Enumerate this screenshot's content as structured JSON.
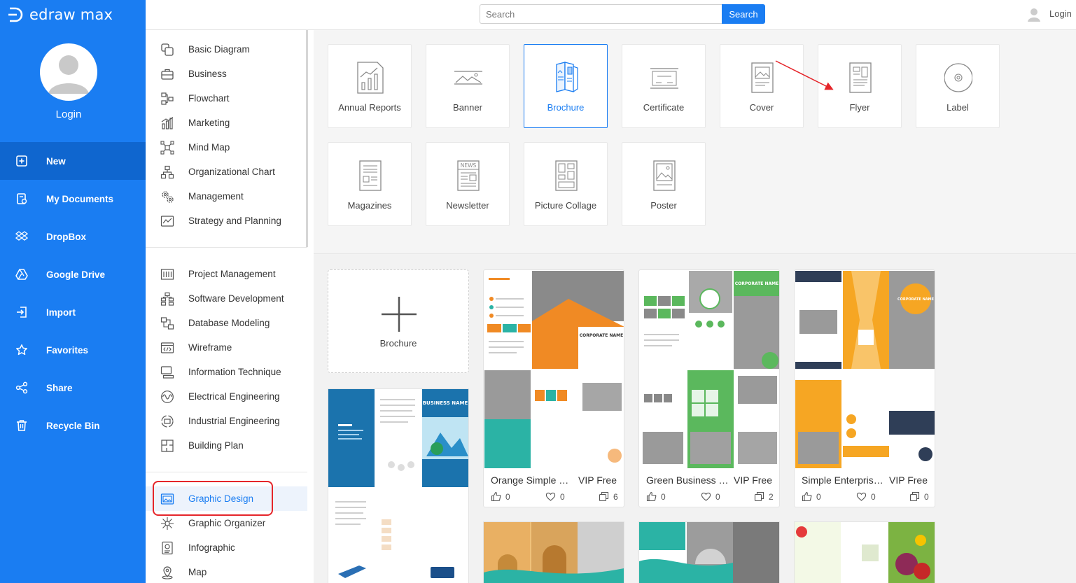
{
  "app": {
    "logo_text": "edraw max"
  },
  "sidebar": {
    "login_label": "Login",
    "nav": [
      {
        "label": "New",
        "icon": "new-file-icon",
        "active": true
      },
      {
        "label": "My Documents",
        "icon": "documents-icon"
      },
      {
        "label": "DropBox",
        "icon": "dropbox-icon"
      },
      {
        "label": "Google Drive",
        "icon": "google-drive-icon"
      },
      {
        "label": "Import",
        "icon": "import-icon"
      },
      {
        "label": "Favorites",
        "icon": "star-icon"
      },
      {
        "label": "Share",
        "icon": "share-icon"
      },
      {
        "label": "Recycle Bin",
        "icon": "trash-icon"
      }
    ]
  },
  "topbar": {
    "search_placeholder": "Search",
    "search_button": "Search",
    "login_label": "Login"
  },
  "categories": {
    "group1": [
      {
        "label": "Basic Diagram",
        "icon": "basic-diagram-icon"
      },
      {
        "label": "Business",
        "icon": "briefcase-icon"
      },
      {
        "label": "Flowchart",
        "icon": "flowchart-icon"
      },
      {
        "label": "Marketing",
        "icon": "bar-chart-icon"
      },
      {
        "label": "Mind Map",
        "icon": "mind-map-icon"
      },
      {
        "label": "Organizational Chart",
        "icon": "org-chart-icon"
      },
      {
        "label": "Management",
        "icon": "gears-icon"
      },
      {
        "label": "Strategy and Planning",
        "icon": "strategy-icon"
      }
    ],
    "group2": [
      {
        "label": "Project Management",
        "icon": "gantt-icon"
      },
      {
        "label": "Software Development",
        "icon": "software-icon"
      },
      {
        "label": "Database Modeling",
        "icon": "database-icon"
      },
      {
        "label": "Wireframe",
        "icon": "wireframe-icon"
      },
      {
        "label": "Information Technique",
        "icon": "network-icon"
      },
      {
        "label": "Electrical Engineering",
        "icon": "electrical-icon"
      },
      {
        "label": "Industrial Engineering",
        "icon": "industrial-icon"
      },
      {
        "label": "Building Plan",
        "icon": "floor-plan-icon"
      }
    ],
    "group3": [
      {
        "label": "Graphic Design",
        "icon": "graphic-design-icon",
        "active": true
      },
      {
        "label": "Graphic Organizer",
        "icon": "graphic-organizer-icon"
      },
      {
        "label": "Infographic",
        "icon": "infographic-icon"
      },
      {
        "label": "Map",
        "icon": "map-pin-icon"
      }
    ]
  },
  "types": [
    {
      "label": "Annual Reports",
      "icon": "annual-report-icon"
    },
    {
      "label": "Banner",
      "icon": "banner-icon"
    },
    {
      "label": "Brochure",
      "icon": "brochure-icon",
      "selected": true
    },
    {
      "label": "Certificate",
      "icon": "certificate-icon"
    },
    {
      "label": "Cover",
      "icon": "cover-icon"
    },
    {
      "label": "Flyer",
      "icon": "flyer-icon"
    },
    {
      "label": "Label",
      "icon": "label-icon"
    },
    {
      "label": "Magazines",
      "icon": "magazine-icon"
    },
    {
      "label": "Newsletter",
      "icon": "newsletter-icon"
    },
    {
      "label": "Picture Collage",
      "icon": "collage-icon"
    },
    {
      "label": "Poster",
      "icon": "poster-icon"
    }
  ],
  "newsletter_icon_text": "NEWS",
  "new_card": {
    "label": "Brochure"
  },
  "templates": [
    {
      "name": "Orange Simple C...",
      "badge": "VIP Free",
      "likes": "0",
      "favorites": "0",
      "copies": "6",
      "accent": "#f08a24"
    },
    {
      "name": "Green Business C...",
      "badge": "VIP Free",
      "likes": "0",
      "favorites": "0",
      "copies": "2",
      "accent": "#5bb85d"
    },
    {
      "name": "Simple Enterprise...",
      "badge": "VIP Free",
      "likes": "0",
      "favorites": "0",
      "copies": "0",
      "accent": "#f6a623"
    }
  ],
  "thumb_texts": {
    "orange": "CORPORATE NAME",
    "green": "CORPORATE NAME",
    "yellow": "CORPORATE NAME",
    "blue": "BUSINESS NAME"
  },
  "colors": {
    "brand": "#1a7df2",
    "highlight": "#e5252a"
  }
}
